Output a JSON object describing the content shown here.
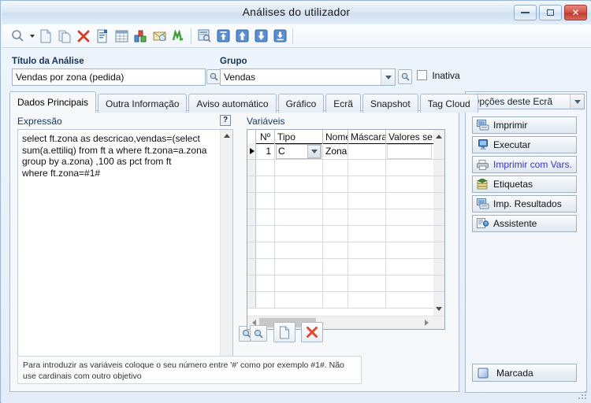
{
  "window": {
    "title": "Análises do utilizador",
    "buttons": {
      "minimize": "minimize-button",
      "maximize": "maximize-button",
      "close": "✕"
    }
  },
  "toolbar": {
    "items": [
      {
        "name": "search-icon",
        "tooltip": "Procurar"
      },
      {
        "name": "dropdown-caret-icon",
        "tooltip": "Opções de procura"
      },
      {
        "name": "new-document-icon",
        "tooltip": "Novo"
      },
      {
        "name": "copy-document-icon",
        "tooltip": "Duplicar"
      },
      {
        "name": "delete-red-x-icon",
        "tooltip": "Eliminar"
      },
      {
        "name": "form-properties-icon",
        "tooltip": "Propriedades"
      },
      {
        "name": "table-grid-icon",
        "tooltip": "Tabela"
      },
      {
        "name": "chart-bar-icon",
        "tooltip": "Gráfico"
      },
      {
        "name": "mail-export-icon",
        "tooltip": "Enviar"
      },
      {
        "name": "refresh-green-icon",
        "tooltip": "Actualizar"
      },
      {
        "name": "preview-icon",
        "tooltip": "Pré-visualizar"
      },
      {
        "name": "first-record-icon",
        "tooltip": "Primeiro"
      },
      {
        "name": "previous-record-icon",
        "tooltip": "Anterior"
      },
      {
        "name": "next-record-icon",
        "tooltip": "Seguinte"
      },
      {
        "name": "last-record-icon",
        "tooltip": "Último"
      }
    ]
  },
  "form": {
    "title_label": "Título da Análise",
    "title_value": "Vendas por zona (pedida)",
    "title_placeholder": "",
    "group_label": "Grupo",
    "group_value": "Vendas",
    "inactive_label": "Inativa",
    "inactive_checked": false
  },
  "tabs": [
    {
      "label": "Dados Principais",
      "active": true
    },
    {
      "label": "Outra Informação",
      "active": false
    },
    {
      "label": "Aviso automático",
      "active": false
    },
    {
      "label": "Gráfico",
      "active": false
    },
    {
      "label": "Ecrã",
      "active": false
    },
    {
      "label": "Snapshot",
      "active": false
    },
    {
      "label": "Tag Cloud",
      "active": false
    }
  ],
  "expression": {
    "label": "Expressão",
    "help_label": "?",
    "text": "select ft.zona as descricao,vendas=(select\nsum(a.ettiliq) from ft a where ft.zona=a.zona\ngroup by a.zona) ,100 as pct from ft\nwhere ft.zona=#1#"
  },
  "variables": {
    "label": "Variáveis",
    "columns": [
      "",
      "Nº",
      "Tipo",
      "Nome",
      "Máscara",
      "Valores se em T"
    ],
    "rows": [
      {
        "selected": true,
        "num": "1",
        "tipo": "C",
        "nome": "Zona",
        "mascara": "",
        "valores": ""
      }
    ],
    "empty_rows": 10,
    "buttons": [
      {
        "name": "lookup-button",
        "icon": "magnifier-icon"
      },
      {
        "name": "new-variable-button",
        "icon": "new-document-icon"
      },
      {
        "name": "delete-variable-button",
        "icon": "red-x-icon"
      }
    ]
  },
  "hint": "Para introduzir as variáveis coloque o seu número entre '#' como por exemplo #1#. Não use cardinais com outro objetivo",
  "options_panel": {
    "header": "Opções deste Ecrã",
    "items": [
      {
        "label": "Imprimir",
        "icon": "print-screen-icon",
        "highlight": false
      },
      {
        "label": "Executar",
        "icon": "monitor-run-icon",
        "highlight": false
      },
      {
        "label": "Imprimir com Vars.",
        "icon": "printer-icon",
        "highlight": true
      },
      {
        "label": "Etiquetas",
        "icon": "labels-icon",
        "highlight": false
      },
      {
        "label": "Imp. Resultados",
        "icon": "print-results-icon",
        "highlight": false
      },
      {
        "label": "Assistente",
        "icon": "wizard-icon",
        "highlight": false
      }
    ],
    "footer_button": {
      "label": "Marcada",
      "icon": "marked-square-icon"
    }
  },
  "colors": {
    "accent": "#3b2fd4",
    "label": "#12335a",
    "frame": "#9bb7d4",
    "close_red": "#bf3c2e"
  }
}
